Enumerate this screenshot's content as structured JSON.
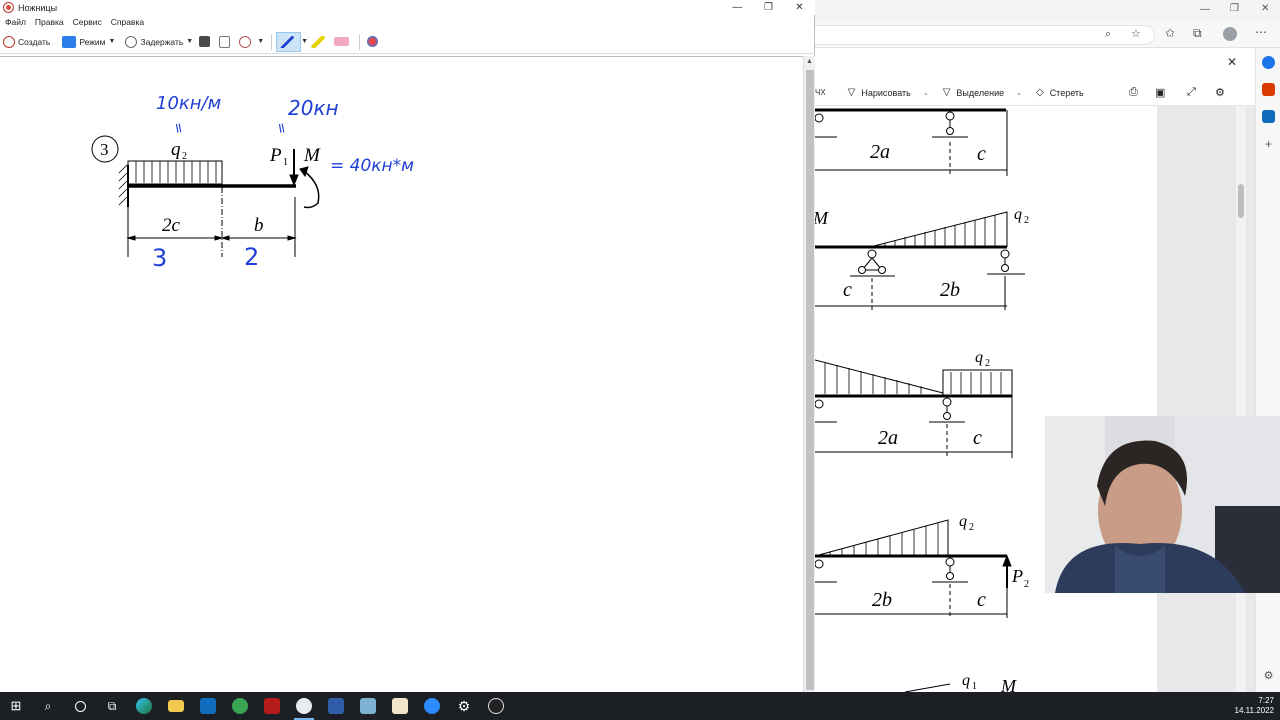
{
  "snipping_tool": {
    "title": "Ножницы",
    "menu": [
      "Файл",
      "Правка",
      "Сервис",
      "Справка"
    ],
    "toolbar": {
      "create": "Создать",
      "mode": "Режим",
      "delay": "Задержать"
    },
    "drawing": {
      "problem_number": "3",
      "load_q_label": "q",
      "load_q_sub": "2",
      "force_label": "P",
      "force_sub": "1",
      "moment_label": "M",
      "span_left": "2c",
      "span_right": "b",
      "handwritten_q": "10кн/м",
      "handwritten_p": "20кн",
      "handwritten_m": "= 40кн*м",
      "handwritten_left": "3",
      "handwritten_right": "2",
      "equals_marks": "=",
      "ink_color": "#1f3fd6"
    }
  },
  "browser": {
    "pdf_tools": {
      "partial": "ЧХ",
      "draw": "Нарисовать",
      "select": "Выделение",
      "erase": "Стереть"
    },
    "diagram_labels": {
      "d1_a": "2a",
      "d1_c": "c",
      "d2_m": "M",
      "d2_q": "q",
      "d2_q_sub": "2",
      "d2_c": "c",
      "d2_b": "2b",
      "d3_q": "q",
      "d3_q_sub": "2",
      "d3_a": "2a",
      "d3_c": "c",
      "d4_q": "q",
      "d4_q_sub": "2",
      "d4_p": "P",
      "d4_p_sub": "2",
      "d4_b": "2b",
      "d4_c": "c",
      "d5_q": "q",
      "d5_q_sub": "1",
      "d5_m": "M"
    }
  },
  "taskbar": {
    "time": "7:27",
    "date": "14.11.2022"
  }
}
